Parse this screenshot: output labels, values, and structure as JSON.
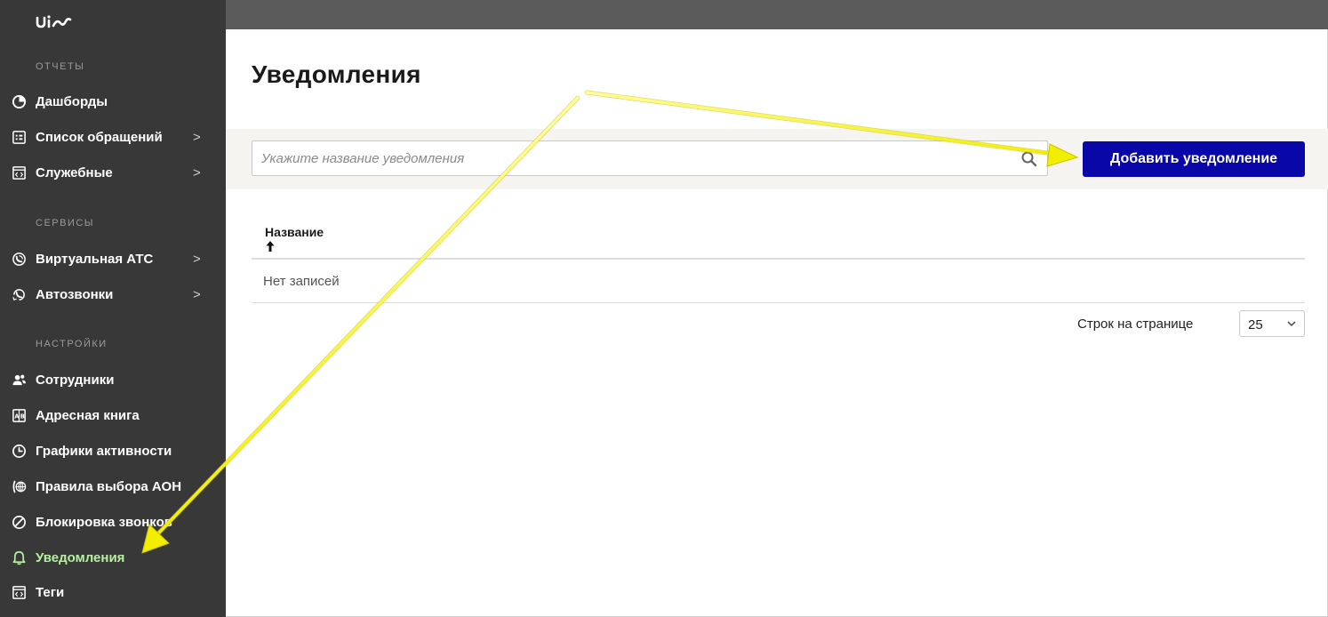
{
  "logo": "uim",
  "sidebar": {
    "sections": [
      {
        "title": "ОТЧЕТЫ",
        "items": [
          {
            "label": "Дашборды",
            "has_children": false
          },
          {
            "label": "Список обращений",
            "has_children": true
          },
          {
            "label": "Служебные",
            "has_children": true
          }
        ]
      },
      {
        "title": "СЕРВИСЫ",
        "items": [
          {
            "label": "Виртуальная АТС",
            "has_children": true
          },
          {
            "label": "Автозвонки",
            "has_children": true
          }
        ]
      },
      {
        "title": "НАСТРОЙКИ",
        "items": [
          {
            "label": "Сотрудники",
            "has_children": false
          },
          {
            "label": "Адресная книга",
            "has_children": false
          },
          {
            "label": "Графики активности",
            "has_children": false
          },
          {
            "label": "Правила выбора АОН",
            "has_children": false
          },
          {
            "label": "Блокировка звонков",
            "has_children": false
          },
          {
            "label": "Уведомления",
            "has_children": false,
            "active": true
          },
          {
            "label": "Теги",
            "has_children": false
          }
        ]
      }
    ],
    "chevron": ">"
  },
  "main": {
    "title": "Уведомления",
    "search": {
      "placeholder": "Укажите название уведомления",
      "value": ""
    },
    "add_button": "Добавить уведомление",
    "table": {
      "columns": [
        "Название"
      ],
      "empty_text": "Нет записей"
    },
    "pagination": {
      "rows_label": "Строк на странице",
      "rows_value": "25"
    }
  },
  "colors": {
    "sidebar_bg": "#383838",
    "topbar_bg": "#5a5a5a",
    "accent": "#0a07a8",
    "active_item": "#b6f0a0",
    "annotation_arrow": "#f2ee00"
  },
  "icons": {
    "dashboards": "pie-chart-icon",
    "requests": "list-icon",
    "service": "code-window-icon",
    "virtual_pbx": "phone-wave-icon",
    "autocalls": "phone-auto-icon",
    "employees": "users-icon",
    "address_book": "address-book-icon",
    "activity": "clock-icon",
    "aon_rules": "phone-globe-icon",
    "call_block": "block-icon",
    "notifications": "bell-icon",
    "tags": "code-window-icon",
    "search": "search-icon",
    "sort": "arrow-up-icon",
    "select": "chevron-down-icon"
  }
}
